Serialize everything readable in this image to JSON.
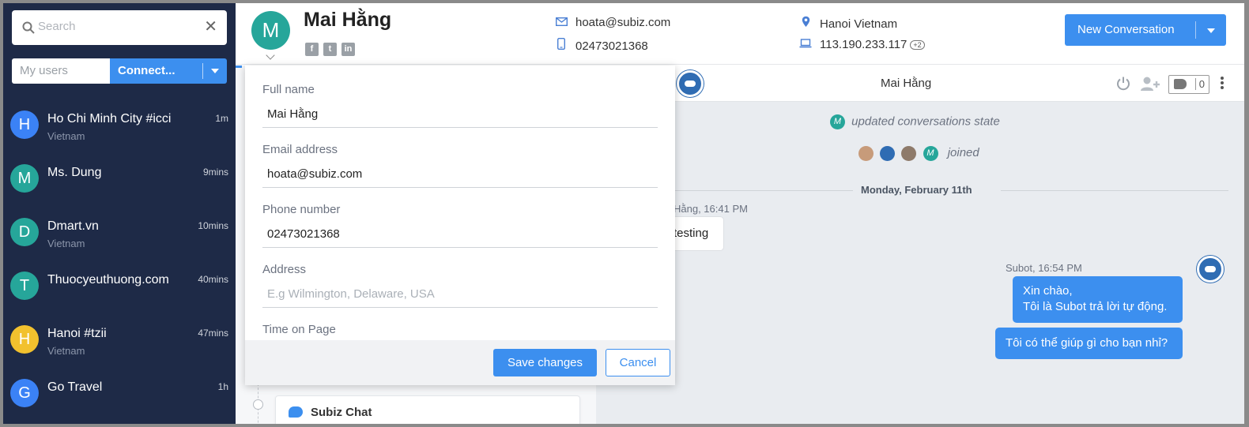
{
  "sidebar": {
    "search_placeholder": "Search",
    "filter_label": "My users",
    "connect_label": "Connect...",
    "conversations": [
      {
        "initial": "H",
        "name": "Ho Chi Minh City #icci",
        "location": "Vietnam",
        "time": "1m",
        "color": "#3b82f6"
      },
      {
        "initial": "M",
        "name": "Ms. Dung",
        "location": "",
        "time": "9mins",
        "color": "#26a69a"
      },
      {
        "initial": "D",
        "name": "Dmart.vn",
        "location": "Vietnam",
        "time": "10mins",
        "color": "#26a69a"
      },
      {
        "initial": "T",
        "name": "Thuocyeuthuong.com",
        "location": "",
        "time": "40mins",
        "color": "#26a69a"
      },
      {
        "initial": "H",
        "name": "Hanoi #tzii",
        "location": "Vietnam",
        "time": "47mins",
        "color": "#f2c12e"
      },
      {
        "initial": "G",
        "name": "Go Travel",
        "location": "",
        "time": "1h",
        "color": "#3b82f6"
      }
    ]
  },
  "header": {
    "avatar_initial": "M",
    "user_name": "Mai Hằng",
    "email": "hoata@subiz.com",
    "phone": "02473021368",
    "location": "Hanoi Vietnam",
    "ip": "113.190.233.117",
    "ip_extra": "+2",
    "new_conversation_label": "New Conversation"
  },
  "chat": {
    "title": "Mai Hằng",
    "tag_count": "0",
    "system_1_avatar": "M",
    "system_1_text": "updated conversations state",
    "system_2_avatar": "M",
    "system_2_text": "joined",
    "date_separator": "Monday, February 11th",
    "incoming_meta": "Hằng, 16:41 PM",
    "incoming_text": "testing",
    "outgoing_meta": "Subot, 16:54 PM",
    "outgoing_line1": "Xin chào,",
    "outgoing_line2": "Tôi là Subot trả lời tự động.",
    "outgoing_2": "Tôi có thể giúp gì cho bạn nhỉ?"
  },
  "timeline": {
    "card_label": "Subiz Chat"
  },
  "popup": {
    "fields": [
      {
        "label": "Full name",
        "value": "Mai Hằng",
        "placeholder": ""
      },
      {
        "label": "Email address",
        "value": "hoata@subiz.com",
        "placeholder": ""
      },
      {
        "label": "Phone number",
        "value": "02473021368",
        "placeholder": ""
      },
      {
        "label": "Address",
        "value": "",
        "placeholder": "E.g Wilmington, Delaware, USA"
      },
      {
        "label": "Time on Page",
        "value": "",
        "placeholder": ""
      }
    ],
    "save_label": "Save changes",
    "cancel_label": "Cancel"
  },
  "colors": {
    "sidebar_bg": "#1e2a47",
    "accent": "#3c8fef",
    "avatar_teal": "#26a69a"
  }
}
